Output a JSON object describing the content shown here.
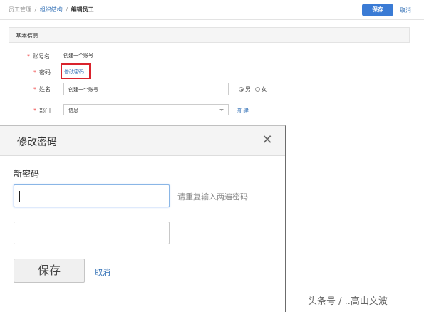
{
  "breadcrumb": {
    "items": [
      "员工管理",
      "组织结构"
    ],
    "separator": "/",
    "current": "编辑员工"
  },
  "toolbar": {
    "save_label": "保存",
    "cancel_label": "取消"
  },
  "section": {
    "title": "基本信息"
  },
  "form": {
    "required_mark": "*",
    "account": {
      "label": "账号名",
      "value": "创建一个账号"
    },
    "password": {
      "label": "密码",
      "link_label": "修改密码"
    },
    "name": {
      "label": "姓名",
      "value": "创建一个账号"
    },
    "gender": {
      "options": [
        "男",
        "女"
      ],
      "selected": "男"
    },
    "department": {
      "label": "部门",
      "value": "信息",
      "new_label": "新建"
    }
  },
  "modal": {
    "title": "修改密码",
    "close_icon": "close-icon",
    "field_label": "新密码",
    "new_password_value": "",
    "confirm_password_value": "",
    "hint": "请重复输入两遍密码",
    "save_label": "保存",
    "cancel_label": "取消"
  },
  "watermark": {
    "text": "头条号 / ..高山文波"
  },
  "colors": {
    "primary": "#3a7bd5",
    "link": "#2e6db4",
    "highlight_border": "#d9232d",
    "required": "#e33333"
  }
}
